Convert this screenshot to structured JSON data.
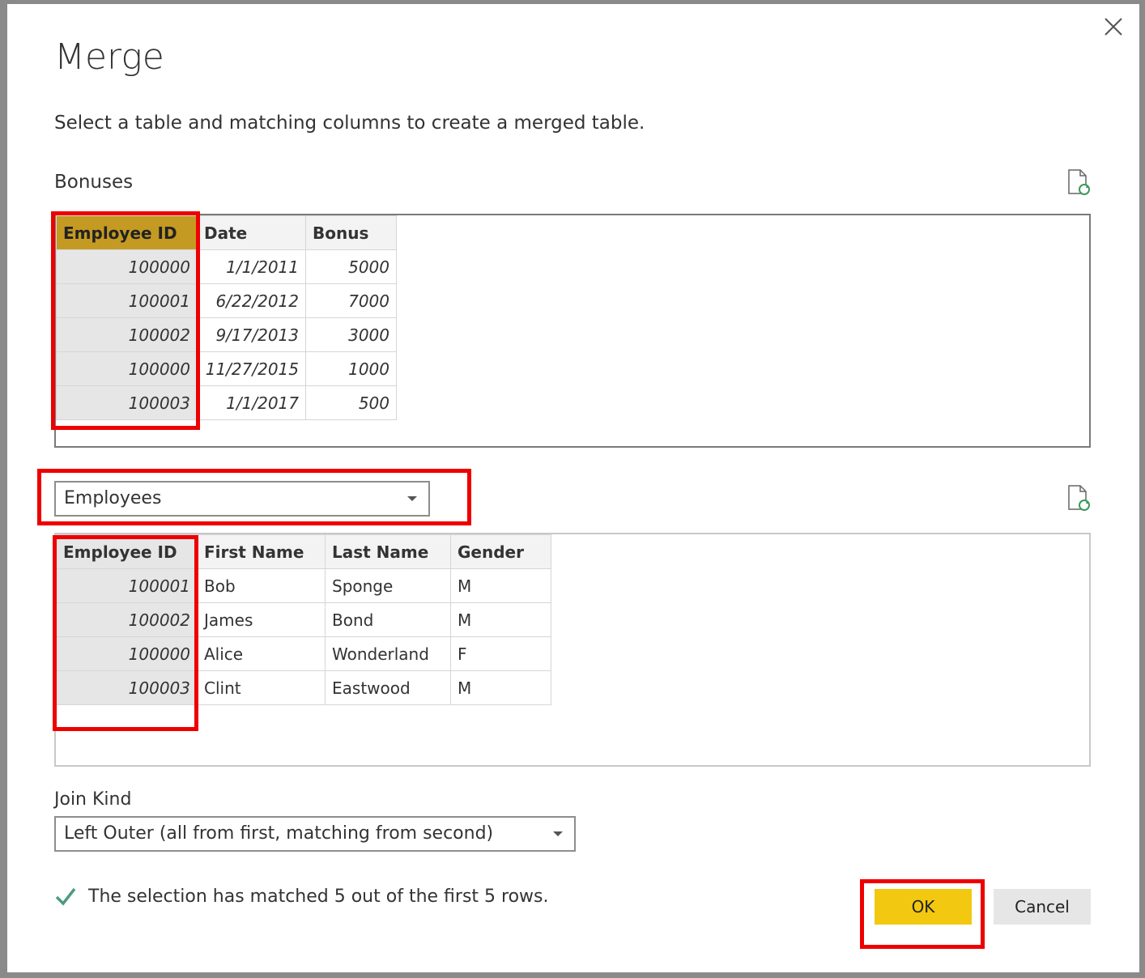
{
  "dialog": {
    "title": "Merge",
    "subtitle": "Select a table and matching columns to create a merged table.",
    "close_icon": "close-icon"
  },
  "first_table": {
    "name": "Bonuses",
    "columns": [
      "Employee ID",
      "Date",
      "Bonus"
    ],
    "rows": [
      [
        "100000",
        "1/1/2011",
        "5000"
      ],
      [
        "100001",
        "6/22/2012",
        "7000"
      ],
      [
        "100002",
        "9/17/2013",
        "3000"
      ],
      [
        "100000",
        "11/27/2015",
        "1000"
      ],
      [
        "100003",
        "1/1/2017",
        "500"
      ]
    ],
    "selected_column": "Employee ID",
    "selected_color": "#c59a22"
  },
  "second_table": {
    "selected_table": "Employees",
    "columns": [
      "Employee ID",
      "First Name",
      "Last Name",
      "Gender"
    ],
    "rows": [
      [
        "100001",
        "Bob",
        "Sponge",
        "M"
      ],
      [
        "100002",
        "James",
        "Bond",
        "M"
      ],
      [
        "100000",
        "Alice",
        "Wonderland",
        "F"
      ],
      [
        "100003",
        "Clint",
        "Eastwood",
        "M"
      ]
    ],
    "selected_column": "Employee ID"
  },
  "join_kind": {
    "label": "Join Kind",
    "value": "Left Outer (all from first, matching from second)"
  },
  "status": {
    "icon": "checkmark-icon",
    "text": "The selection has matched 5 out of the first 5 rows."
  },
  "buttons": {
    "ok_label": "OK",
    "cancel_label": "Cancel",
    "ok_color": "#f2c811"
  },
  "highlight_color": "#ee0000"
}
